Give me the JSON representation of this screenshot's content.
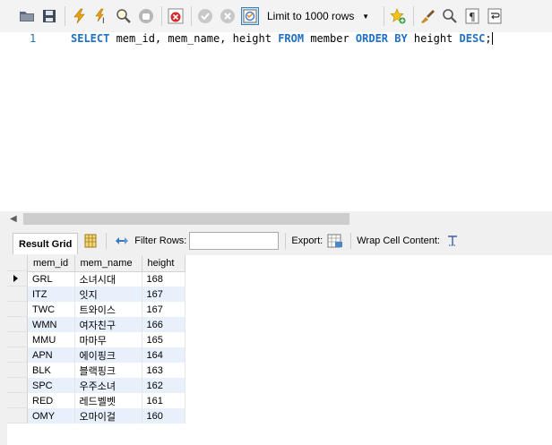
{
  "toolbar": {
    "icons": [
      "folder-open-icon",
      "save-icon",
      "execute-lightning-icon",
      "execute-cursor-icon",
      "explain-magnifier-icon",
      "stop-icon",
      "toggle-error-icon",
      "commit-icon",
      "rollback-icon",
      "autocommit-icon",
      "star-add-icon",
      "beautify-brush-icon",
      "find-icon",
      "invisible-chars-icon",
      "wrap-icon"
    ],
    "limit_select": "Limit to 1000 rows"
  },
  "editor": {
    "line_number": "1",
    "code_parts": [
      {
        "text": "SELECT",
        "type": "keyword"
      },
      {
        "text": " mem_id, mem_name, height ",
        "type": "plain"
      },
      {
        "text": "FROM",
        "type": "keyword"
      },
      {
        "text": " member ",
        "type": "plain"
      },
      {
        "text": "ORDER BY",
        "type": "keyword"
      },
      {
        "text": " height ",
        "type": "plain"
      },
      {
        "text": "DESC",
        "type": "keyword"
      },
      {
        "text": ";",
        "type": "plain"
      }
    ]
  },
  "result_toolbar": {
    "result_grid_label": "Result Grid",
    "filter_rows_label": "Filter Rows:",
    "filter_value": "",
    "export_label": "Export:",
    "wrap_label": "Wrap Cell Content:"
  },
  "grid": {
    "columns": [
      "mem_id",
      "mem_name",
      "height"
    ],
    "rows": [
      [
        "GRL",
        "소녀시대",
        "168"
      ],
      [
        "ITZ",
        "잇지",
        "167"
      ],
      [
        "TWC",
        "트와이스",
        "167"
      ],
      [
        "WMN",
        "여자친구",
        "166"
      ],
      [
        "MMU",
        "마마무",
        "165"
      ],
      [
        "APN",
        "에이핑크",
        "164"
      ],
      [
        "BLK",
        "블랙핑크",
        "163"
      ],
      [
        "SPC",
        "우주소녀",
        "162"
      ],
      [
        "RED",
        "레드벨벳",
        "161"
      ],
      [
        "OMY",
        "오마이걸",
        "160"
      ]
    ]
  },
  "colors": {
    "keyword": "#1e70c6",
    "line_number": "#1f6fa8",
    "row_alt": "#e8f0fb",
    "toolbar_bg": "#f3f3f3"
  }
}
